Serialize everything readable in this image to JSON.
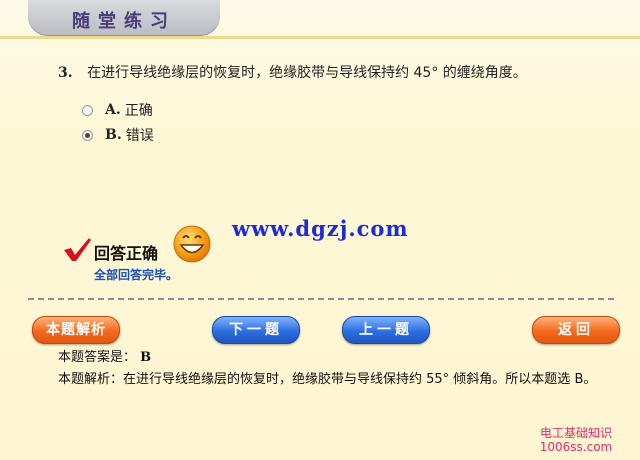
{
  "header": {
    "title": "随堂练习"
  },
  "question": {
    "number": "3.",
    "text": "在进行导线绝缘层的恢复时，绝缘胶带与导线保持约 45° 的缠绕角度。"
  },
  "options": [
    {
      "letter": "A.",
      "label": "正确",
      "selected": false
    },
    {
      "letter": "B.",
      "label": "错误",
      "selected": true
    }
  ],
  "watermark": "www.dgzj.com",
  "result": {
    "title": "回答正确",
    "subtitle": "全部回答完毕。"
  },
  "buttons": {
    "analysis": "本题解析",
    "next": "下一题",
    "prev": "上一题",
    "back": "返回"
  },
  "answer": {
    "label": "本题答案是：",
    "value": "B"
  },
  "analysis": {
    "text": "本题解析：在进行导线绝缘层的恢复时，绝缘胶带与导线保持约 55° 倾斜角。所以本题选 B。"
  },
  "site_mark": {
    "line1": "电工基础知识",
    "line2": "1006ss.com"
  },
  "colors": {
    "accent_orange": "#f36a1c",
    "accent_blue": "#2c6fe0",
    "watermark_blue": "#1d2bd6"
  }
}
